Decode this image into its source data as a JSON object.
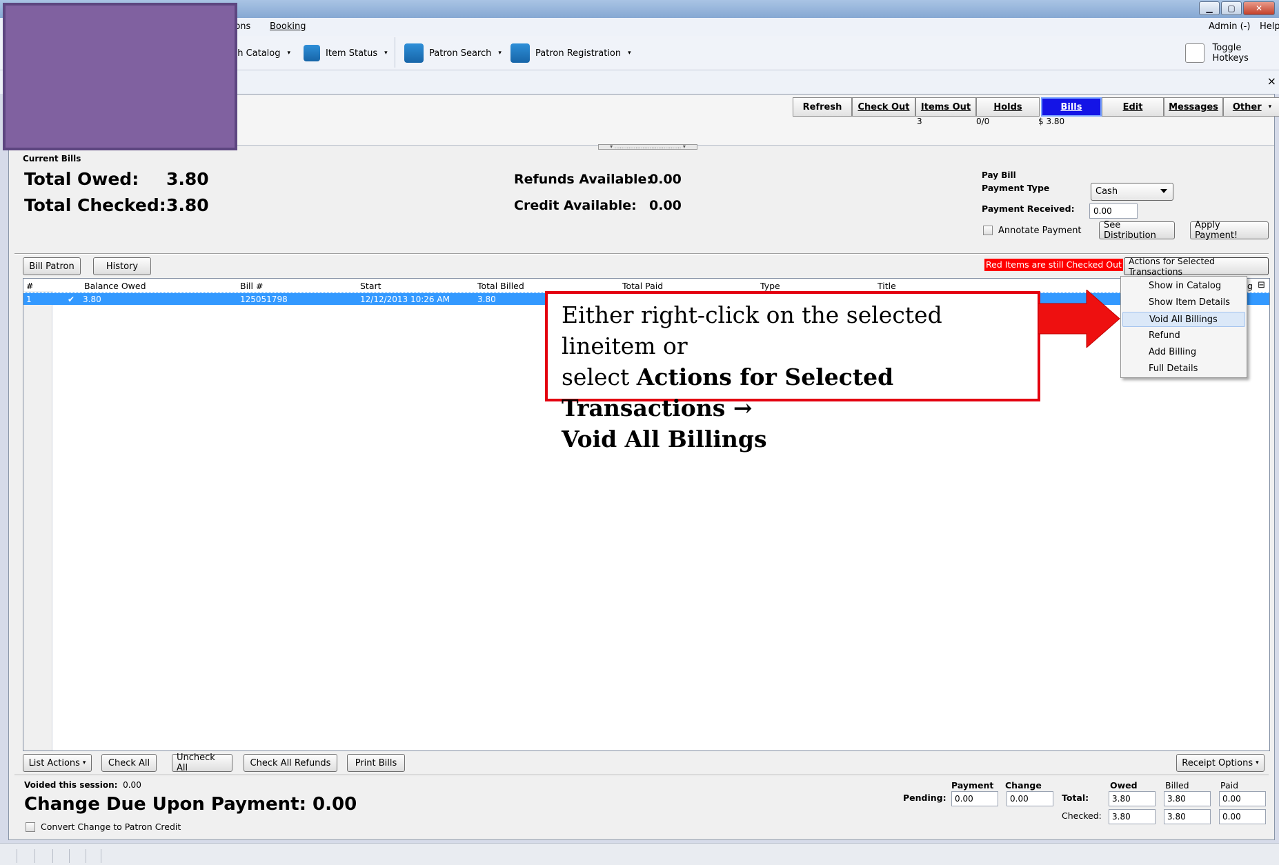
{
  "menubar": {
    "items": [
      "itions",
      "Booking"
    ],
    "right": [
      "Admin (-)",
      "Help"
    ]
  },
  "toolbar": {
    "search_catalog": "rch Catalog",
    "item_status": "Item Status",
    "patron_search": "Patron Search",
    "patron_registration": "Patron Registration",
    "toggle_hotkeys": "Toggle Hotkeys"
  },
  "tab_close": "×",
  "patron_nav": {
    "buttons": [
      {
        "label": "Refresh",
        "sub": ""
      },
      {
        "label": "Check Out",
        "sub": ""
      },
      {
        "label": "Items Out",
        "sub": "3"
      },
      {
        "label": "Holds",
        "sub": "0/0"
      },
      {
        "label": "Bills",
        "sub": "$ 3.80",
        "active": true
      },
      {
        "label": "Edit",
        "sub": ""
      },
      {
        "label": "Messages",
        "sub": ""
      },
      {
        "label": "Other",
        "sub": ""
      }
    ]
  },
  "bills": {
    "section_label": "Current Bills",
    "total_owed_label": "Total Owed:",
    "total_owed_value": "3.80",
    "total_checked_label": "Total Checked:",
    "total_checked_value": "3.80",
    "refunds_label": "Refunds Available:",
    "refunds_value": "0.00",
    "credit_label": "Credit Available:",
    "credit_value": "0.00"
  },
  "pay_bill": {
    "title": "Pay Bill",
    "payment_type_label": "Payment Type",
    "payment_type_value": "Cash",
    "payment_received_label": "Payment Received:",
    "payment_received_value": "0.00",
    "annotate_label": "Annotate Payment",
    "see_distribution": "See Distribution",
    "apply_payment": "Apply Payment!"
  },
  "actions_bar": {
    "bill_patron": "Bill Patron",
    "history": "History",
    "red_note": "Red Items are still Checked Out",
    "actions_menu": "Actions for Selected Transactions"
  },
  "grid": {
    "columns": [
      "#",
      "Balance Owed",
      "Bill #",
      "Start",
      "Total Billed",
      "Total Paid",
      "Type",
      "Title",
      "g"
    ],
    "rows": [
      {
        "num": "1",
        "check": "✔",
        "balance": "3.80",
        "bill": "125051798",
        "start": "12/12/2013 10:26 AM",
        "billed": "3.80"
      }
    ]
  },
  "context_menu": {
    "items": [
      "Show in Catalog",
      "Show Item Details",
      "Void All Billings",
      "Refund",
      "Add Billing",
      "Full Details"
    ],
    "highlighted": "Void All Billings"
  },
  "callout": {
    "line1": "Either right-click on the selected lineitem or",
    "line2_prefix": "select",
    "line2_bold": "Actions for Selected Transactions →",
    "line3_bold": "Void All Billings"
  },
  "bottom": {
    "list_actions": "List Actions",
    "check_all": "Check All",
    "uncheck_all": "Uncheck All",
    "check_all_refunds": "Check All Refunds",
    "print_bills": "Print Bills",
    "receipt_options": "Receipt Options",
    "voided_label": "Voided this session:",
    "voided_value": "0.00",
    "change_due_label": "Change Due Upon Payment:",
    "change_due_value": "0.00",
    "convert_label": "Convert Change to Patron Credit"
  },
  "totals": {
    "payment_hd": "Payment",
    "change_hd": "Change",
    "pending_label": "Pending:",
    "pending_payment": "0.00",
    "pending_change": "0.00",
    "owed_hd": "Owed",
    "billed_hd": "Billed",
    "paid_hd": "Paid",
    "total_label": "Total:",
    "checked_label": "Checked:",
    "total_owed": "3.80",
    "total_billed": "3.80",
    "total_paid": "0.00",
    "checked_owed": "3.80",
    "checked_billed": "3.80",
    "checked_paid": "0.00"
  },
  "colors": {
    "active_tab": "#1414e6",
    "selected_row": "#3399ff",
    "callout_border": "#e3000f",
    "redaction": "#8061a0"
  }
}
